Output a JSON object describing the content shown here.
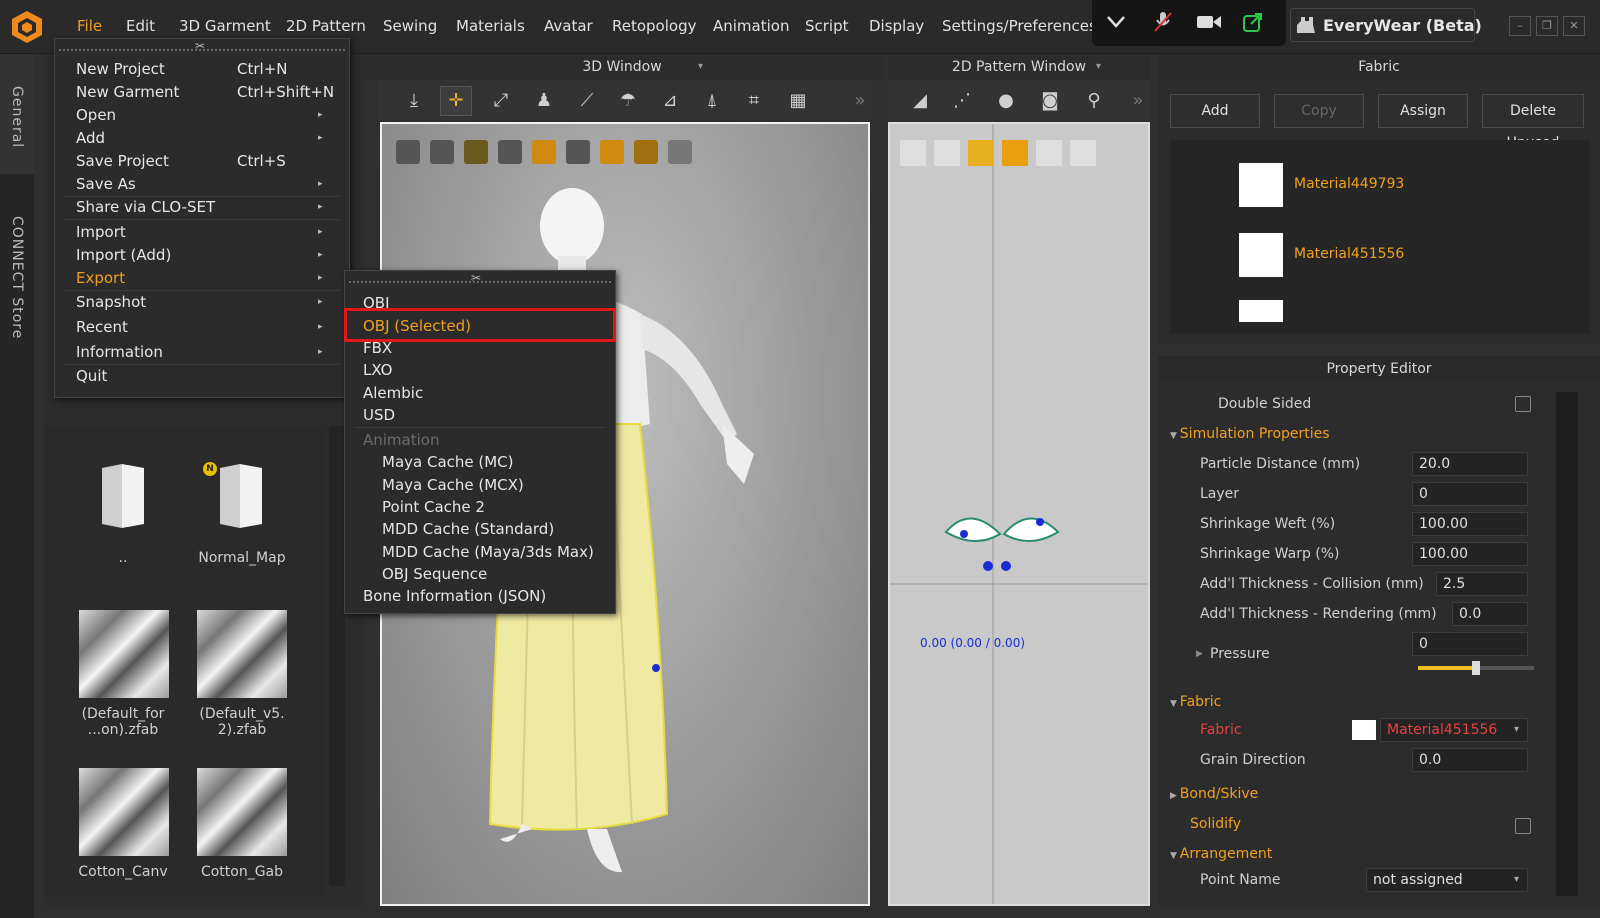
{
  "menubar": {
    "items": [
      "File",
      "Edit",
      "3D Garment",
      "2D Pattern",
      "Sewing",
      "Materials",
      "Avatar",
      "Retopology",
      "Animation",
      "Script",
      "Display",
      "Settings/Preferences"
    ],
    "workspace_label": "EveryWear (Beta)"
  },
  "left_tabs": [
    "General",
    "CONNECT Store"
  ],
  "file_menu": {
    "items": [
      {
        "label": "New Project",
        "shortcut": "Ctrl+N"
      },
      {
        "label": "New Garment",
        "shortcut": "Ctrl+Shift+N"
      },
      {
        "label": "Open",
        "shortcut": ""
      },
      {
        "label": "Add",
        "shortcut": ""
      },
      {
        "label": "Save Project",
        "shortcut": "Ctrl+S"
      },
      {
        "label": "Save As",
        "shortcut": ""
      },
      {
        "label": "Share via CLO-SET",
        "shortcut": ""
      },
      {
        "label": "Import",
        "shortcut": ""
      },
      {
        "label": "Import (Add)",
        "shortcut": ""
      },
      {
        "label": "Export",
        "shortcut": ""
      },
      {
        "label": "Snapshot",
        "shortcut": ""
      },
      {
        "label": "Recent",
        "shortcut": ""
      },
      {
        "label": "Information",
        "shortcut": ""
      },
      {
        "label": "Quit",
        "shortcut": ""
      }
    ]
  },
  "export_menu": {
    "items": [
      "OBJ",
      "OBJ (Selected)",
      "FBX",
      "LXO",
      "Alembic",
      "USD"
    ],
    "animation_header": "Animation",
    "animation_items": [
      "Maya Cache (MC)",
      "Maya Cache (MCX)",
      "Point Cache 2",
      "MDD Cache (Standard)",
      "MDD Cache (Maya/3ds Max)",
      "OBJ Sequence"
    ],
    "bone_item": "Bone Information (JSON)"
  },
  "library": {
    "items": [
      "..",
      "Normal_Map",
      "(Default_for\n...on).zfab",
      "(Default_v5.\n2).zfab",
      "Cotton_Canv",
      "Cotton_Gab"
    ],
    "badge": "N"
  },
  "windows": {
    "window3d_title": "3D Window",
    "window2d_title": "2D Pattern Window",
    "coordinate_readout": "0.00 (0.00 / 0.00)"
  },
  "fabric_panel": {
    "title": "Fabric",
    "buttons": {
      "add": "Add",
      "copy": "Copy",
      "assign": "Assign",
      "delete_unused": "Delete Unused"
    },
    "materials": [
      "Material449793",
      "Material451556"
    ]
  },
  "property_editor": {
    "title": "Property Editor",
    "double_sided_label": "Double Sided",
    "simulation_header": "Simulation Properties",
    "simulation_rows": [
      {
        "label": "Particle Distance (mm)",
        "value": "20.0"
      },
      {
        "label": "Layer",
        "value": "0"
      },
      {
        "label": "Shrinkage Weft (%)",
        "value": "100.00"
      },
      {
        "label": "Shrinkage Warp (%)",
        "value": "100.00"
      },
      {
        "label": "Add'l Thickness - Collision (mm)",
        "value": "2.5"
      },
      {
        "label": "Add'l Thickness - Rendering (mm)",
        "value": "0.0"
      }
    ],
    "pressure_label": "Pressure",
    "pressure_value": "0",
    "pressure_slider_fraction": 0.5,
    "fabric_header": "Fabric",
    "fabric_row_label": "Fabric",
    "fabric_row_value": "Material451556",
    "grain_label": "Grain Direction",
    "grain_value": "0.0",
    "bond_header": "Bond/Skive",
    "solidify_label": "Solidify",
    "arrangement_header": "Arrangement",
    "point_name_label": "Point Name",
    "point_name_value": "not assigned"
  },
  "colors": {
    "accent": "#f0a020",
    "selection_box": "#e01818",
    "fabric_label": "#e84040"
  }
}
